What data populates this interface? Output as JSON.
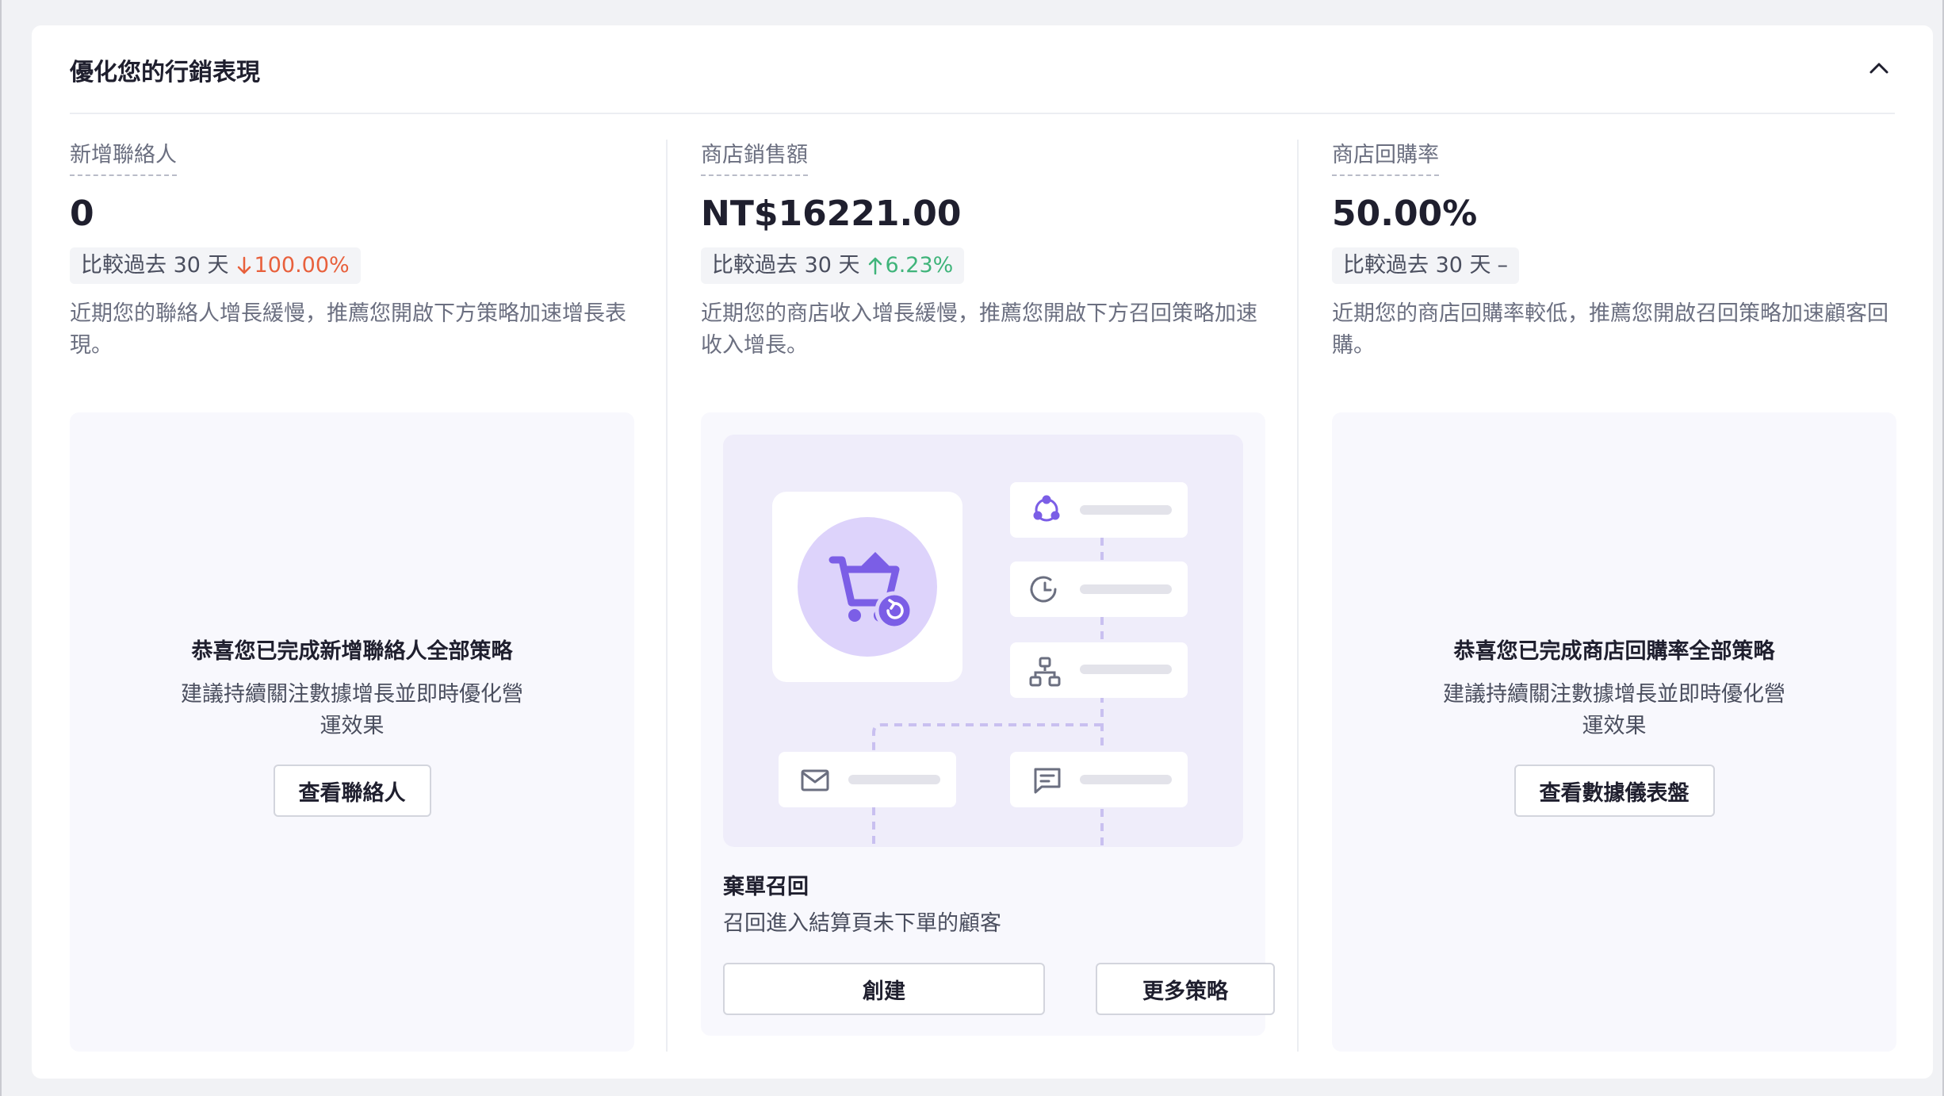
{
  "header": {
    "title": "優化您的行銷表現",
    "collapse_icon": "chevron-up-icon"
  },
  "metrics": [
    {
      "label": "新增聯絡人",
      "value": "0",
      "compare_text": "比較過去 30 天",
      "trend": "down",
      "change": "100.00%",
      "advice": "近期您的聯絡人增長緩慢，推薦您開啟下方策略加速增長表現。",
      "done_title": "恭喜您已完成新增聯絡人全部策略",
      "done_desc": "建議持續關注數據增長並即時優化營運效果",
      "button": "查看聯絡人"
    },
    {
      "label": "商店銷售額",
      "value": "NT$16221.00",
      "compare_text": "比較過去 30 天",
      "trend": "up",
      "change": "6.23%",
      "advice": "近期您的商店收入增長緩慢，推薦您開啟下方召回策略加速收入增長。",
      "strategy": {
        "title": "棄單召回",
        "desc": "召回進入結算頁未下單的顧客",
        "create_button": "創建",
        "more_button": "更多策略"
      }
    },
    {
      "label": "商店回購率",
      "value": "50.00%",
      "compare_text": "比較過去 30 天",
      "trend": "flat",
      "change": "–",
      "advice": "近期您的商店回購率較低，推薦您開啟召回策略加速顧客回購。",
      "done_title": "恭喜您已完成商店回購率全部策略",
      "done_desc": "建議持續關注數據增長並即時優化營運效果",
      "button": "查看數據儀表盤"
    }
  ],
  "colors": {
    "trend_down": "#e8603c",
    "trend_up": "#3fb47a",
    "accent_purple": "#7b5ee6",
    "illus_bg": "#efedfa"
  }
}
